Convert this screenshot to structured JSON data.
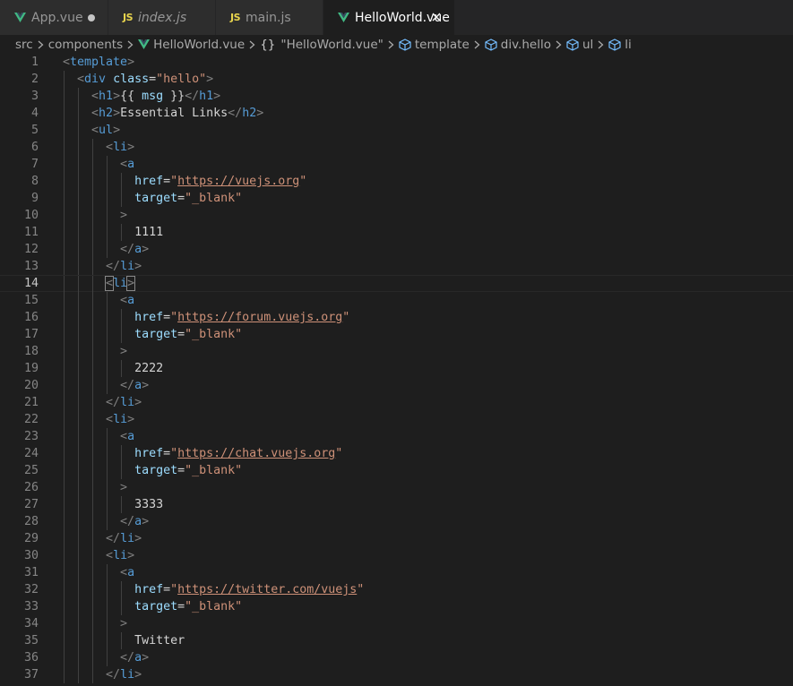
{
  "tabs": [
    {
      "label": "App.vue",
      "icon": "vue-icon",
      "italic": false,
      "state": "modified"
    },
    {
      "label": "index.js",
      "icon": "js-icon",
      "italic": true,
      "state": "normal"
    },
    {
      "label": "main.js",
      "icon": "js-icon",
      "italic": false,
      "state": "normal"
    },
    {
      "label": "HelloWorld.vue",
      "icon": "vue-icon",
      "italic": false,
      "state": "active"
    }
  ],
  "js_badge": "JS",
  "breadcrumb": {
    "items": [
      "src",
      "components",
      "HelloWorld.vue",
      "\"HelloWorld.vue\"",
      "template",
      "div.hello",
      "ul",
      "li"
    ],
    "object_glyph": "{}"
  },
  "colors": {
    "vue": "#41b883",
    "js": "#e8d44d",
    "cube": "#75beff",
    "tag": "#569cd6",
    "attr": "#9cdcfe",
    "string": "#ce9178"
  },
  "editor": {
    "current_line": 14,
    "lines": [
      {
        "n": "1",
        "code": "<template>"
      },
      {
        "n": "2",
        "code": "  <div class=\"hello\">"
      },
      {
        "n": "3",
        "code": "    <h1>{{ msg }}</h1>"
      },
      {
        "n": "4",
        "code": "    <h2>Essential Links</h2>"
      },
      {
        "n": "5",
        "code": "    <ul>"
      },
      {
        "n": "6",
        "code": "      <li>"
      },
      {
        "n": "7",
        "code": "        <a"
      },
      {
        "n": "8",
        "code": "          href=\"https://vuejs.org\""
      },
      {
        "n": "9",
        "code": "          target=\"_blank\""
      },
      {
        "n": "10",
        "code": "        >"
      },
      {
        "n": "11",
        "code": "          1111"
      },
      {
        "n": "12",
        "code": "        </a>"
      },
      {
        "n": "13",
        "code": "      </li>"
      },
      {
        "n": "14",
        "code": "      <li>"
      },
      {
        "n": "15",
        "code": "        <a"
      },
      {
        "n": "16",
        "code": "          href=\"https://forum.vuejs.org\""
      },
      {
        "n": "17",
        "code": "          target=\"_blank\""
      },
      {
        "n": "18",
        "code": "        >"
      },
      {
        "n": "19",
        "code": "          2222"
      },
      {
        "n": "20",
        "code": "        </a>"
      },
      {
        "n": "21",
        "code": "      </li>"
      },
      {
        "n": "22",
        "code": "      <li>"
      },
      {
        "n": "23",
        "code": "        <a"
      },
      {
        "n": "24",
        "code": "          href=\"https://chat.vuejs.org\""
      },
      {
        "n": "25",
        "code": "          target=\"_blank\""
      },
      {
        "n": "26",
        "code": "        >"
      },
      {
        "n": "27",
        "code": "          3333"
      },
      {
        "n": "28",
        "code": "        </a>"
      },
      {
        "n": "29",
        "code": "      </li>"
      },
      {
        "n": "30",
        "code": "      <li>"
      },
      {
        "n": "31",
        "code": "        <a"
      },
      {
        "n": "32",
        "code": "          href=\"https://twitter.com/vuejs\""
      },
      {
        "n": "33",
        "code": "          target=\"_blank\""
      },
      {
        "n": "34",
        "code": "        >"
      },
      {
        "n": "35",
        "code": "          Twitter"
      },
      {
        "n": "36",
        "code": "        </a>"
      },
      {
        "n": "37",
        "code": "      </li>"
      }
    ]
  }
}
